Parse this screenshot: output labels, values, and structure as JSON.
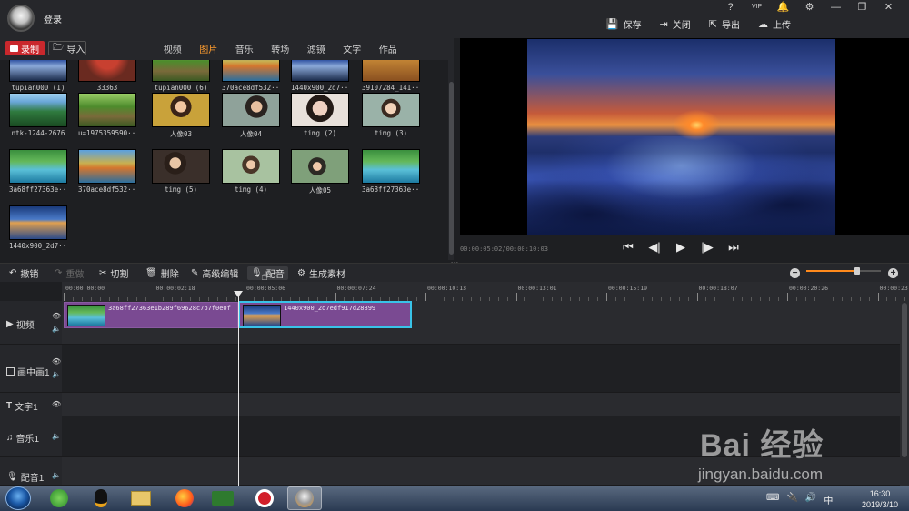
{
  "app": {
    "login_label": "登录",
    "window_controls": [
      "?",
      "VIP",
      "🔔",
      "⚙",
      "—",
      "❐",
      "✕"
    ],
    "top_actions": [
      {
        "icon": "save-icon",
        "label": "保存"
      },
      {
        "icon": "close-project-icon",
        "label": "关闭"
      },
      {
        "icon": "export-icon",
        "label": "导出"
      },
      {
        "icon": "upload-icon",
        "label": "上传"
      }
    ]
  },
  "library_bar": {
    "record_label": "录制",
    "import_label": "导入",
    "tabs": [
      "视频",
      "图片",
      "音乐",
      "转场",
      "滤镜",
      "文字",
      "作品"
    ],
    "active_tab": "图片"
  },
  "library": {
    "items": [
      {
        "caption": "tupian000 (1)",
        "style": "g-night"
      },
      {
        "caption": "33363",
        "style": "g-red"
      },
      {
        "caption": "tupian000 (6)",
        "style": "g-road"
      },
      {
        "caption": "370ace8df532···",
        "style": "g-autumn"
      },
      {
        "caption": "1440x900_2d7···",
        "style": "g-night"
      },
      {
        "caption": "39107284_141···",
        "style": "g-warm"
      },
      {
        "caption": "ntk-1244-2676",
        "style": "g-forest"
      },
      {
        "caption": "u=1975359590···",
        "style": "g-road"
      },
      {
        "caption": "人像03",
        "style": "g-girl"
      },
      {
        "caption": "人像04",
        "style": "g-girl2"
      },
      {
        "caption": "timg (2)",
        "style": "g-girl3"
      },
      {
        "caption": "timg (3)",
        "style": "g-girl4"
      },
      {
        "caption": "3a68ff27363e···",
        "style": "g-lake"
      },
      {
        "caption": "370ace8df532···",
        "style": "g-autumn"
      },
      {
        "caption": "timg (5)",
        "style": "g-girl5"
      },
      {
        "caption": "timg (4)",
        "style": "g-girl6"
      },
      {
        "caption": "人像05",
        "style": "g-girl7"
      },
      {
        "caption": "3a68ff27363e···",
        "style": "g-lake"
      },
      {
        "caption": "1440x900_2d7···",
        "style": "g-sea"
      }
    ]
  },
  "preview": {
    "time_readout": "00:00:05:02/00:00:10:03",
    "transport": [
      "⏮",
      "◀|",
      "▶",
      "|▶",
      "⏭"
    ]
  },
  "edit_toolbar": {
    "buttons": [
      {
        "icon": "undo-icon",
        "label": "撤销",
        "enabled": true
      },
      {
        "icon": "redo-icon",
        "label": "重做",
        "enabled": false
      },
      {
        "icon": "scissors-icon",
        "label": "切割",
        "enabled": true
      },
      {
        "icon": "trash-icon",
        "label": "删除",
        "enabled": true
      },
      {
        "icon": "pencil-icon",
        "label": "高级编辑",
        "enabled": true
      },
      {
        "icon": "microphone-icon",
        "label": "配音",
        "enabled": true
      },
      {
        "icon": "film-reel-icon",
        "label": "生成素材",
        "enabled": true
      }
    ],
    "zoom_level": 0.68
  },
  "timeline": {
    "ruler_labels": [
      "00:00:00:00",
      "00:00:02:18",
      "00:00:05:06",
      "00:00:07:24",
      "00:00:10:13",
      "00:00:13:01",
      "00:00:15:19",
      "00:00:18:07",
      "00:00:20:26",
      "00:00:23:"
    ],
    "tracks": [
      {
        "name": "视频",
        "icon": "play-icon",
        "toggles": [
          "👁",
          "🔈"
        ]
      },
      {
        "name": "画中画1",
        "icon": "pip-icon",
        "toggles": [
          "👁",
          "🔈"
        ]
      },
      {
        "name": "文字1",
        "icon": "text-icon",
        "toggles": [
          "👁"
        ]
      },
      {
        "name": "音乐1",
        "icon": "music-icon",
        "toggles": [
          "🔈"
        ]
      },
      {
        "name": "配音1",
        "icon": "microphone-icon",
        "toggles": [
          "🔈"
        ]
      }
    ],
    "clips": [
      {
        "label": "3a68ff27363e1b289f69628c7b7f0e0f",
        "style": "g-lake",
        "selected": false
      },
      {
        "label": "1440x900_2d7edf917d28899",
        "style": "g-sea",
        "selected": true
      }
    ]
  },
  "watermark": {
    "logo": "Bai 经验",
    "url": "jingyan.baidu.com"
  },
  "taskbar": {
    "time": "16:30",
    "date": "2019/3/10",
    "tray_icons": [
      "⌨",
      "🔌",
      "🔊",
      "中"
    ]
  }
}
